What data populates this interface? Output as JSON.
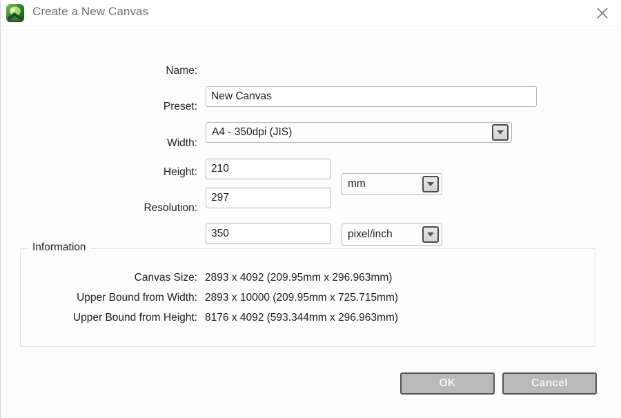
{
  "window": {
    "title": "Create a New Canvas",
    "app_icon": "canvas-app-icon",
    "close_icon": "close-icon"
  },
  "form": {
    "name": {
      "label": "Name:",
      "value": "New Canvas",
      "placeholder": ""
    },
    "preset": {
      "label": "Preset:",
      "value": "A4 - 350dpi (JIS)",
      "dropdown_icon": "chevron-down-icon"
    },
    "width": {
      "label": "Width:",
      "value": "210"
    },
    "height": {
      "label": "Height:",
      "value": "297"
    },
    "size_unit": {
      "value": "mm",
      "dropdown_icon": "chevron-down-icon"
    },
    "resolution": {
      "label": "Resolution:",
      "value": "350"
    },
    "resolution_unit": {
      "value": "pixel/inch",
      "dropdown_icon": "chevron-down-icon"
    }
  },
  "information": {
    "legend": "Information",
    "rows": [
      {
        "label": "Canvas Size:",
        "value": "2893 x 4092 (209.95mm x 296.963mm)"
      },
      {
        "label": "Upper Bound from Width:",
        "value": "2893 x 10000 (209.95mm x 725.715mm)"
      },
      {
        "label": "Upper Bound from Height:",
        "value": "8176 x 4092 (593.344mm x 296.963mm)"
      }
    ]
  },
  "footer": {
    "ok_label": "OK",
    "cancel_label": "Cancel"
  },
  "colors": {
    "button_face": "#b9b9b9",
    "button_border": "#555555",
    "button_text": "#f2f2f2",
    "field_border": "#b4b4b4",
    "title_text": "#6e6e6e",
    "body_text": "#1c1c1c",
    "window_bg": "#fdfdfd"
  }
}
